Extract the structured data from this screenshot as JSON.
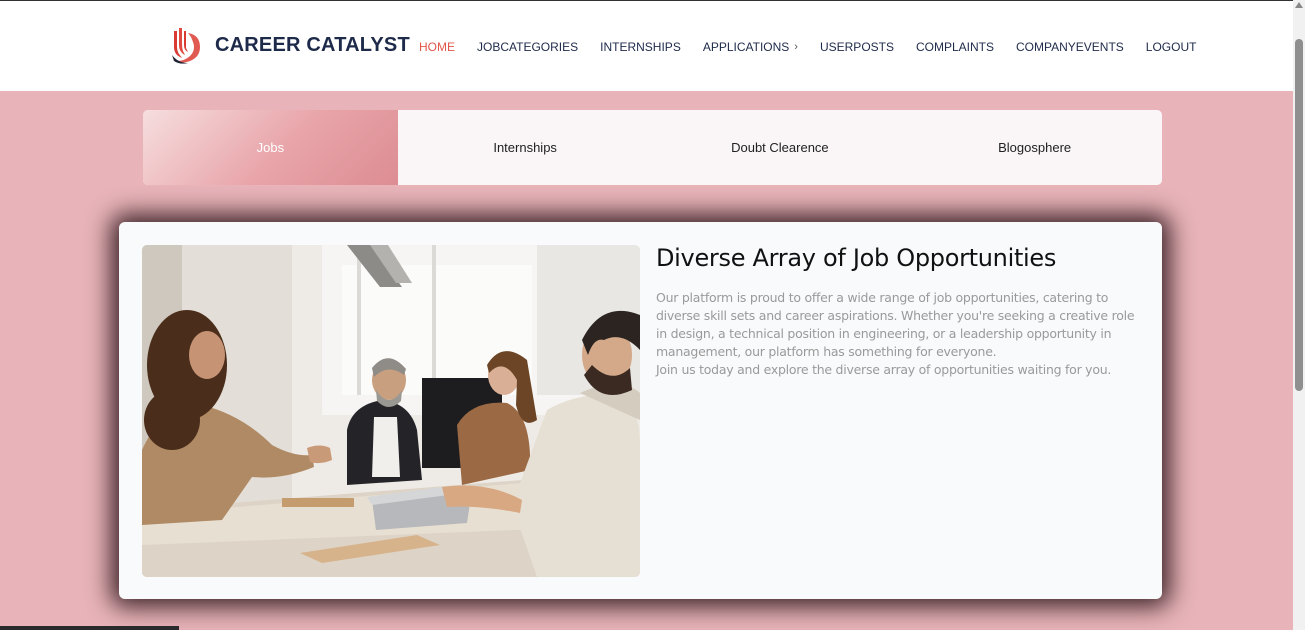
{
  "brand": {
    "name": "CAREER CATALYST"
  },
  "nav": {
    "items": [
      {
        "label": "HOME",
        "active": true
      },
      {
        "label": "JOBCATEGORIES"
      },
      {
        "label": "INTERNSHIPS"
      },
      {
        "label": "APPLICATIONS",
        "has_dropdown": true
      },
      {
        "label": "USERPOSTS"
      },
      {
        "label": "COMPLAINTS"
      },
      {
        "label": "COMPANYEVENTS"
      },
      {
        "label": "LOGOUT"
      }
    ]
  },
  "tabs": [
    {
      "label": "Jobs",
      "active": true
    },
    {
      "label": "Internships"
    },
    {
      "label": "Doubt Clearence"
    },
    {
      "label": "Blogosphere"
    }
  ],
  "feature": {
    "title": "Diverse Array of Job Opportunities",
    "paragraph1": "Our platform is proud to offer a wide range of job opportunities, catering to diverse skill sets and career aspirations. Whether you're seeking a creative role in design, a technical position in engineering, or a leadership opportunity in management, our platform has something for everyone.",
    "paragraph2": "Join us today and explore the diverse array of opportunities waiting for you."
  },
  "colors": {
    "page_background": "#e8b4b9",
    "accent": "#e0574a",
    "brand_text": "#1e2a4a",
    "active_tab": "#dc8d93"
  },
  "icons": {
    "logo": "career-catalyst-logo-icon",
    "dropdown": "chevron-right-icon"
  }
}
